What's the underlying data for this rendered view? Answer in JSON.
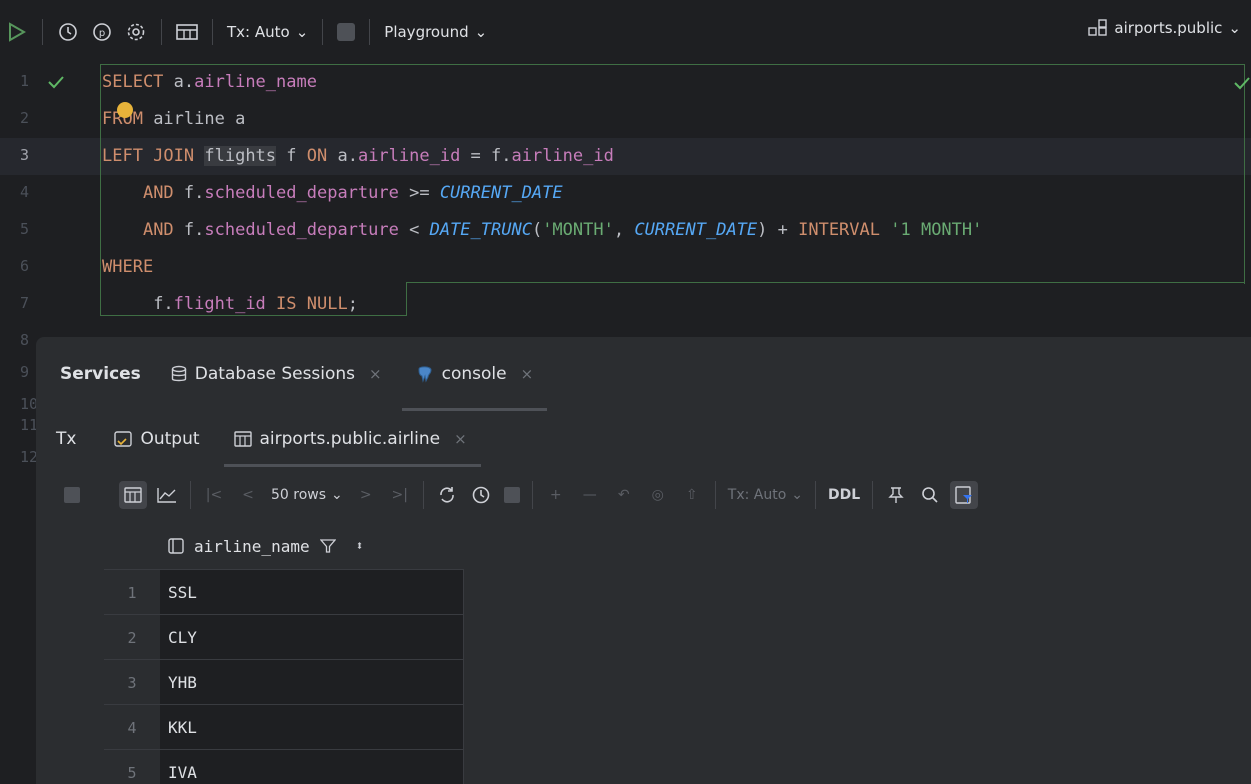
{
  "toolbar": {
    "tx_label": "Tx: Auto",
    "playground_label": "Playground",
    "schema_label": "airports.public"
  },
  "editor": {
    "line_numbers": [
      "1",
      "2",
      "3",
      "4",
      "5",
      "6",
      "7",
      "8",
      "9",
      "10",
      "11",
      "12"
    ],
    "code": {
      "l1_kw": "SELECT",
      "l1_rest": " a.",
      "l1_field": "airline_name",
      "l2_kw": "FROM",
      "l2_rest": " airline a",
      "l3_kw": "LEFT JOIN",
      "l3_table": "flights",
      "l3_mid": " f ",
      "l3_on": "ON",
      "l3_a": " a.",
      "l3_f1": "airline_id",
      "l3_eq": " = f.",
      "l3_f2": "airline_id",
      "l4_kw": "AND",
      "l4_a": " f.",
      "l4_field": "scheduled_departure",
      "l4_op": " >= ",
      "l4_fn": "CURRENT_DATE",
      "l5_kw": "AND",
      "l5_a": " f.",
      "l5_field": "scheduled_departure",
      "l5_op": " < ",
      "l5_fn1": "DATE_TRUNC",
      "l5_p": "(",
      "l5_str": "'MONTH'",
      "l5_c": ", ",
      "l5_fn2": "CURRENT_DATE",
      "l5_p2": ") + ",
      "l5_kw2": "INTERVAL",
      "l5_sp": " ",
      "l5_str2": "'1 MONTH'",
      "l6_kw": "WHERE",
      "l7_a": "f.",
      "l7_field": "flight_id",
      "l7_kw": " IS NULL",
      "l7_end": ";"
    }
  },
  "services": {
    "title": "Services",
    "tabs": [
      {
        "label": "Database Sessions"
      },
      {
        "label": "console"
      }
    ],
    "close_glyph": "×",
    "tx_short": "Tx",
    "sub_tabs": [
      {
        "label": "Output"
      },
      {
        "label": "airports.public.airline"
      }
    ],
    "grid_toolbar": {
      "rows_label": "50 rows",
      "tx_label": "Tx: Auto",
      "ddl_label": "DDL"
    },
    "table": {
      "column": "airline_name",
      "rows": [
        {
          "n": "1",
          "v": "SSL"
        },
        {
          "n": "2",
          "v": "CLY"
        },
        {
          "n": "3",
          "v": "YHB"
        },
        {
          "n": "4",
          "v": "KKL"
        },
        {
          "n": "5",
          "v": "IVA"
        }
      ]
    }
  }
}
